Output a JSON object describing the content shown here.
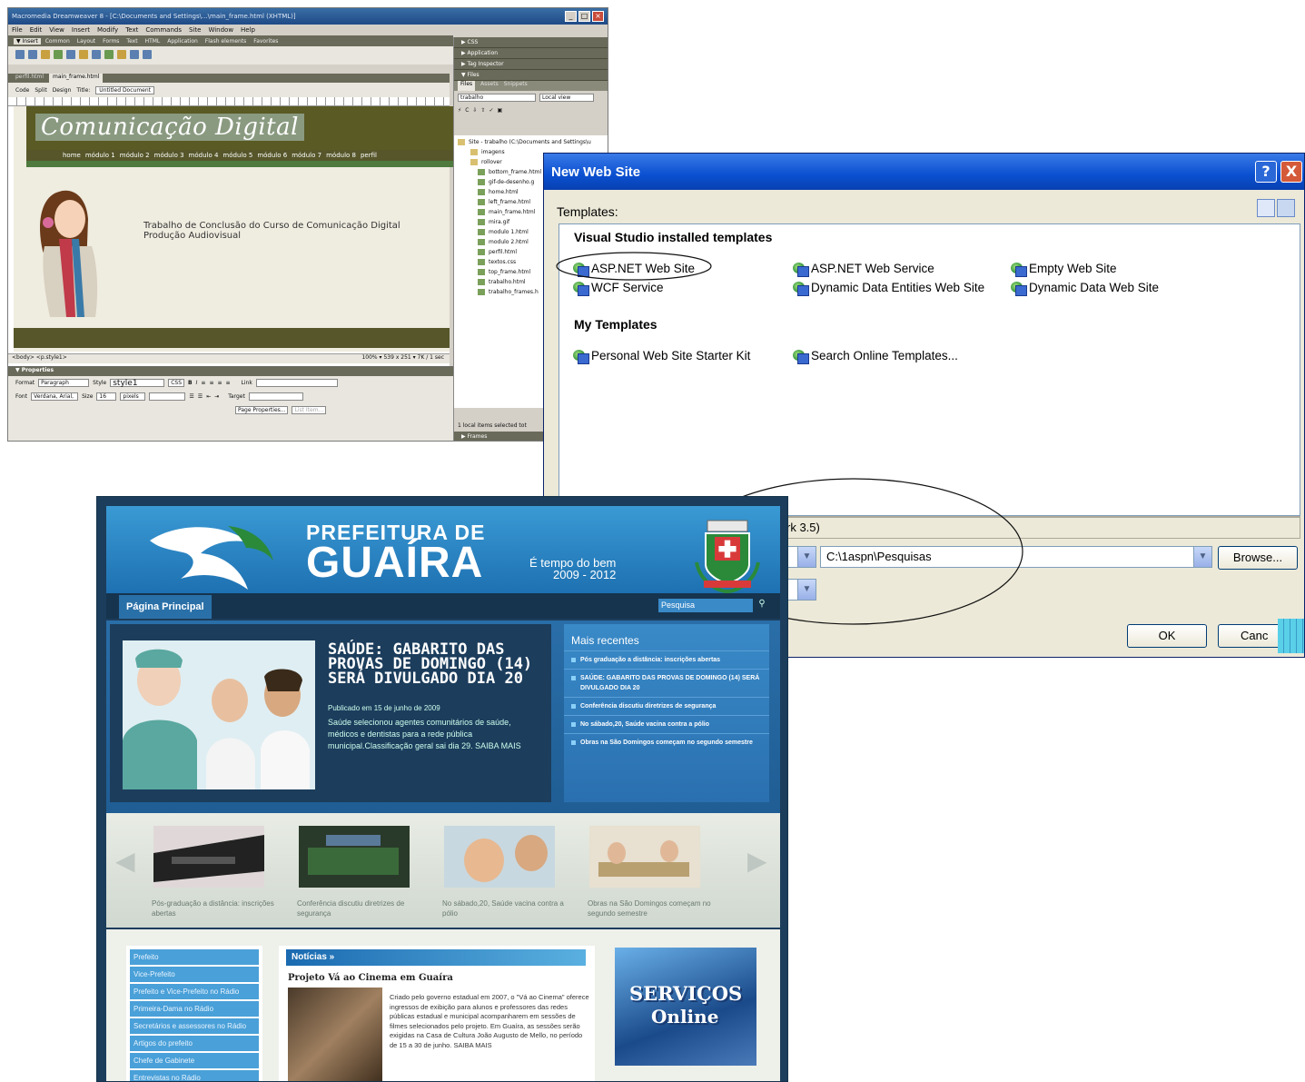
{
  "dreamweaver": {
    "title": "Macromedia Dreamweaver 8 - [C:\\Documents and Settings\\...\\main_frame.html (XHTML)]",
    "menu": [
      "File",
      "Edit",
      "View",
      "Insert",
      "Modify",
      "Text",
      "Commands",
      "Site",
      "Window",
      "Help"
    ],
    "insert_tabs": [
      "▼ Insert",
      "Common",
      "Layout",
      "Forms",
      "Text",
      "HTML",
      "Application",
      "Flash elements",
      "Favorites"
    ],
    "doc_tabs": [
      "perfil.html",
      "main_frame.html"
    ],
    "view_buttons": [
      "Code",
      "Split",
      "Design"
    ],
    "title_label": "Title:",
    "title_value": "Untitled Document",
    "logo_text": "Comunicação Digital",
    "nav": [
      "home",
      "módulo 1",
      "módulo 2",
      "módulo 3",
      "módulo 4",
      "módulo 5",
      "módulo 6",
      "módulo 7",
      "módulo 8",
      "perfil"
    ],
    "page_text_line1": "Trabalho de Conclusão do Curso de Comunicação Digital",
    "page_text_line2": "Produção Audiovisual",
    "status_tag": "<body> <p.style1>",
    "status_info": "100%  ▾ 539 x 251 ▾ 7K / 1 sec",
    "props": {
      "header": "▼ Properties",
      "format_label": "Format",
      "format_value": "Paragraph",
      "style_label": "Style",
      "style_value": "style1",
      "css_btn": "CSS",
      "link_label": "Link",
      "font_label": "Font",
      "font_value": "Verdana, Arial,",
      "size_label": "Size",
      "size_value": "16",
      "unit_value": "pixels",
      "target_label": "Target",
      "page_props_btn": "Page Properties...",
      "list_item_btn": "List Item..."
    },
    "panels": {
      "css": "▶ CSS",
      "application": "▶ Application",
      "tag_inspector": "▶ Tag Inspector",
      "files": "▼ Files",
      "files_tabs": [
        "Files",
        "Assets",
        "Snippets"
      ],
      "site_select": "trabalho",
      "view_select": "Local view",
      "site_root": "Site - trabalho (C:\\Documents and Settings\\u",
      "tree": [
        "imagens",
        "rollover",
        "bottom_frame.html",
        "gif-de-desenho.g",
        "home.html",
        "left_frame.html",
        "main_frame.html",
        "mira.gif",
        "modulo 1.html",
        "modulo 2.html",
        "perfil.html",
        "textos.css",
        "top_frame.html",
        "trabalho.html",
        "trabalho_frames.h"
      ],
      "status": "1 local items selected tot",
      "frames": "▶ Frames"
    }
  },
  "vs_dialog": {
    "title": "New Web Site",
    "help_btn": "?",
    "close_btn": "X",
    "templates_label": "Templates:",
    "group_installed": "Visual Studio installed templates",
    "group_my": "My Templates",
    "installed": [
      "ASP.NET Web Site",
      "ASP.NET Web Service",
      "Empty Web Site",
      "WCF Service",
      "Dynamic Data Entities Web Site",
      "Dynamic Data Web Site"
    ],
    "my": [
      "Personal Web Site Starter Kit",
      "Search Online Templates..."
    ],
    "framework_text": "rk 3.5)",
    "location_value": "C:\\1aspn\\Pesquisas",
    "browse_btn": "Browse...",
    "ok_btn": "OK",
    "cancel_btn": "Canc"
  },
  "guaira": {
    "title_line1": "PREFEITURA DE",
    "title_line2": "GUAÍRA",
    "tagline1": "É tempo do bem",
    "tagline2": "2009 - 2012",
    "nav_home": "Página Principal",
    "search_placeholder": "Pesquisa",
    "headline": "SAÚDE: GABARITO DAS PROVAS DE DOMINGO (14) SERÁ DIVULGADO DIA 20",
    "published": "Publicado em 15 de junho de 2009",
    "summary": "Saúde selecionou agentes comunitários de saúde, médicos e dentistas para a rede pública municipal.Classificação geral sai dia 29. SAIBA MAIS",
    "recent_title": "Mais recentes",
    "recent": [
      "Pós graduação a distância: inscrições abertas",
      "SAÚDE: GABARITO DAS PROVAS DE DOMINGO (14) SERÁ DIVULGADO DIA 20",
      "Conferência discutiu diretrizes de segurança",
      "No sábado,20, Saúde vacina contra a pólio",
      "Obras na São Domingos começam no segundo semestre"
    ],
    "gallery": [
      "Pós-graduação a distância: inscrições abertas",
      "Conferência discutiu diretrizes de segurança",
      "No sábado,20, Saúde vacina contra a pólio",
      "Obras na São Domingos começam no segundo semestre"
    ],
    "sidebar": [
      "Prefeito",
      "Vice-Prefeito",
      "Prefeito e Vice-Prefeito no Rádio",
      "Primeira-Dama no Rádio",
      "Secretários e assessores no Rádio",
      "Artigos do prefeito",
      "Chefe de Gabinete",
      "Entrevistas no Rádio"
    ],
    "news_header": "Notícias »",
    "news_title": "Projeto Vá ao Cinema em Guaíra",
    "news_body": "Criado pelo governo estadual em 2007, o \"Vá ao Cinema\" oferece ingressos de exibição para alunos e professores das redes públicas estadual e municipal acompanharem em sessões de filmes selecionados pelo projeto. Em Guaíra, as sessões serão exigidas na Casa de Cultura João Augusto de Mello, no período de 15 a 30 de junho. SAIBA MAIS",
    "services1": "SERVIÇOS",
    "services2": "Online"
  }
}
